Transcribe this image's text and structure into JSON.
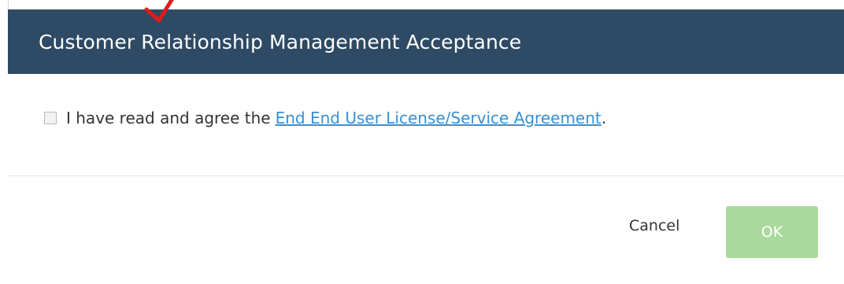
{
  "dialog": {
    "title": "Customer Relationship Management Acceptance",
    "header_color": "#2e4a64",
    "agreement": {
      "checked": false,
      "prefix_text": "I have read and agree the",
      "link_text": "End End User License/Service Agreement ",
      "suffix_text": ".",
      "link_color": "#3a8fd0"
    },
    "buttons": {
      "cancel_label": "Cancel",
      "ok_label": "OK",
      "ok_color": "#a9d99c"
    }
  },
  "annotation": {
    "arrow_icon": "red-pointer-arrow-icon",
    "arrow_color": "#e01b1b"
  }
}
